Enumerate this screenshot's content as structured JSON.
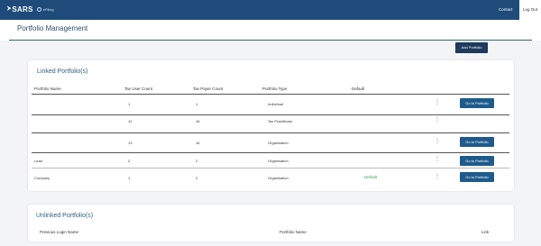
{
  "header": {
    "logo_mark": "⮞",
    "logo_text": "SARS",
    "efiling_label": "eFiling",
    "contact_label": "Contact",
    "logout_label": "Log Out"
  },
  "page": {
    "title": "Portfolio Management",
    "add_button_label": "Add Portfolio"
  },
  "linked": {
    "title": "Linked Portfolio(s)",
    "columns": [
      "Portfolio Name",
      "Tax User Count",
      "Tax Payer Count",
      "Portfolio Type",
      "Default"
    ],
    "action_label": "Go to Portfolio",
    "rows": [
      {
        "name": "",
        "tax_user_count": "1",
        "tax_payer_count": "1",
        "type": "Individual",
        "default": ""
      },
      {
        "name": "",
        "tax_user_count": "12",
        "tax_payer_count": "16",
        "type": "Tax Practitioner",
        "default": ""
      },
      {
        "name": "",
        "tax_user_count": "13",
        "tax_payer_count": "16",
        "type": "Organisation",
        "default": ""
      },
      {
        "name": "Lead",
        "tax_user_count": "2",
        "tax_payer_count": "2",
        "type": "Organisation",
        "default": ""
      },
      {
        "name": "Company",
        "tax_user_count": "1",
        "tax_payer_count": "2",
        "type": "Organisation",
        "default": "Default"
      }
    ]
  },
  "unlinked": {
    "title": "Unlinked Portfolio(s)",
    "columns": [
      "Previous Login Name",
      "Portfolio Name",
      "Link"
    ]
  },
  "colors": {
    "topbar": "#1e4b7a",
    "button_dark": "#1e3a5c",
    "button_blue": "#1e5a8c",
    "default_green": "#3aa34a"
  },
  "icons": {
    "row_menu": "kebab-menu-icon"
  }
}
